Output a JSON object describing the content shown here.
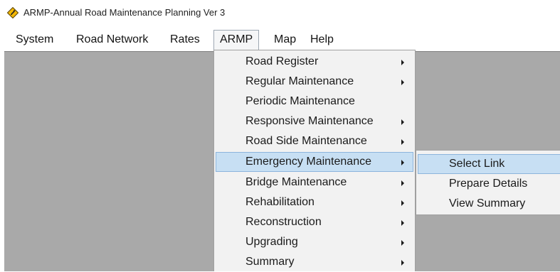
{
  "window": {
    "title": "ARMP-Annual Road Maintenance Planning Ver 3",
    "icon": "road-sign-icon"
  },
  "menubar": {
    "items": [
      {
        "label": "System"
      },
      {
        "label": "Road Network"
      },
      {
        "label": "Rates"
      },
      {
        "label": "ARMP",
        "active": true
      },
      {
        "label": "Map"
      },
      {
        "label": "Help"
      }
    ]
  },
  "armp_menu": {
    "items": [
      {
        "label": "Road Register",
        "has_submenu": true
      },
      {
        "label": "Regular Maintenance",
        "has_submenu": true
      },
      {
        "label": "Periodic Maintenance",
        "has_submenu": false
      },
      {
        "label": "Responsive Maintenance",
        "has_submenu": true
      },
      {
        "label": "Road Side Maintenance",
        "has_submenu": true
      },
      {
        "label": "Emergency Maintenance",
        "has_submenu": true,
        "highlighted": true
      },
      {
        "label": "Bridge Maintenance",
        "has_submenu": true
      },
      {
        "label": "Rehabilitation",
        "has_submenu": true
      },
      {
        "label": "Reconstruction",
        "has_submenu": true
      },
      {
        "label": "Upgrading",
        "has_submenu": true
      },
      {
        "label": "Summary",
        "has_submenu": true
      }
    ]
  },
  "emergency_submenu": {
    "items": [
      {
        "label": "Select Link",
        "highlighted": true
      },
      {
        "label": "Prepare Details"
      },
      {
        "label": "View Summary"
      }
    ]
  },
  "colors": {
    "workspace": "#a9a9a9",
    "menu_background": "#f2f2f2",
    "highlight": "#c7dff3",
    "highlight_border": "#8cb4dc",
    "icon_fill": "#f2b705"
  }
}
